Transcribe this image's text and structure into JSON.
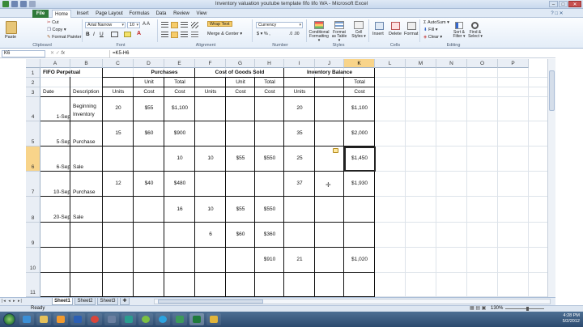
{
  "window": {
    "title": "Inventory valuation youtube template fifo lifo WA - Microsoft Excel",
    "buttons": [
      "–",
      "□",
      "✕"
    ]
  },
  "tabs": [
    "File",
    "Home",
    "Insert",
    "Page Layout",
    "Formulas",
    "Data",
    "Review",
    "View"
  ],
  "ribbon": {
    "clipboard": {
      "paste": "Paste",
      "cut": "Cut",
      "copy": "Copy ▾",
      "format_painter": "Format Painter",
      "label": "Clipboard"
    },
    "font": {
      "name": "Arial Narrow",
      "size": "10",
      "label": "Font"
    },
    "alignment": {
      "wrap": "Wrap Text",
      "merge": "Merge & Center ▾",
      "label": "Alignment"
    },
    "number": {
      "format": "Currency",
      "symbols": "$ ▾  %  ,",
      "label": "Number"
    },
    "styles": {
      "cond": "Conditional Formatting ▾",
      "table": "Format as Table ▾",
      "cell": "Cell Styles ▾",
      "label": "Styles"
    },
    "cells": {
      "insert": "Insert",
      "delete": "Delete",
      "format": "Format",
      "label": "Cells"
    },
    "editing": {
      "autosum": "AutoSum ▾",
      "fill": "Fill ▾",
      "clear": "Clear ▾",
      "sort": "Sort & Filter ▾",
      "find": "Find & Select ▾",
      "label": "Editing"
    }
  },
  "formula_bar": {
    "name_box": "K6",
    "fx": "fx",
    "formula": "=K5-H6"
  },
  "columns": [
    "A",
    "B",
    "C",
    "D",
    "E",
    "F",
    "G",
    "H",
    "I",
    "J",
    "K",
    "L",
    "M",
    "N",
    "O",
    "P"
  ],
  "selected_column": "K",
  "rows": [
    "1",
    "2",
    "3",
    "4",
    "5",
    "6",
    "7",
    "8",
    "9",
    "10",
    "11"
  ],
  "selected_row": "6",
  "sheet": {
    "title": "FIFO Perpetual",
    "purchases": "Purchases",
    "cogs": "Cost of Goods Sold",
    "inventory_balance": "Inventory Balance",
    "unit": "Unit",
    "total": "Total",
    "date": "Date",
    "description": "Description",
    "units": "Units",
    "cost": "Cost",
    "r4": {
      "date": "1-Sep",
      "desc_a": "Beginning",
      "desc_b": "Inventory",
      "c": "20",
      "d": "$55",
      "e": "$1,100",
      "i": "20",
      "k": "$1,100"
    },
    "r5": {
      "date": "5-Sep",
      "desc": "Purchase",
      "c": "15",
      "d": "$60",
      "e": "$900",
      "i": "35",
      "k": "$2,000"
    },
    "r6": {
      "date": "6-Sep",
      "desc": "Sale",
      "e": "10",
      "f": "10",
      "g": "$55",
      "h": "$550",
      "i": "25",
      "k": "$1,450"
    },
    "r7": {
      "date": "10-Sep",
      "desc": "Purchase",
      "c": "12",
      "d": "$40",
      "e": "$480",
      "i": "37",
      "k": "$1,930"
    },
    "r8": {
      "date": "20-Sep",
      "desc": "Sale",
      "e": "16",
      "f": "10",
      "g": "$55",
      "h": "$550"
    },
    "r9": {
      "f": "6",
      "g": "$60",
      "h": "$360"
    },
    "r10": {
      "h": "$910",
      "i": "21",
      "k": "$1,020"
    }
  },
  "sheet_tabs": [
    "Sheet1",
    "Sheet2",
    "Sheet3"
  ],
  "status": {
    "ready": "Ready",
    "zoom": "130%"
  },
  "clock": {
    "time": "4:28 PM",
    "date": "5/2/2012"
  },
  "colors": {
    "file_tab": "#2f7a3a",
    "selection_header": "#f8d48a",
    "taskbar": "#2c4a6e"
  }
}
